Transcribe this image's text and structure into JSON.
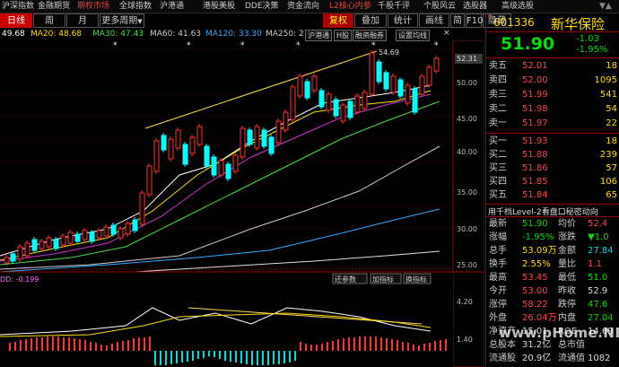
{
  "topnav": {
    "items": [
      "沪深指数",
      "金融期货",
      "期权市场",
      "全球指数",
      "沪港通",
      "港股美股",
      "DDE决策",
      "资金流向",
      "L2核心内参",
      "千股千评",
      "个股风云",
      "选股器",
      "高级选股"
    ],
    "active_index": 2,
    "highlight_index": 8,
    "arrows": "▼▲"
  },
  "toolbar": {
    "left_buttons": [
      "日线",
      "周",
      "月",
      "更多周期"
    ],
    "more_arrow": "▼",
    "right_buttons": [
      "复权",
      "叠加",
      "统计",
      "画线",
      "简",
      "F10",
      "隐藏"
    ]
  },
  "ma_legend": {
    "items": [
      {
        "text": "49.68",
        "color": "#ffffff"
      },
      {
        "text": "MA20: 48.68",
        "color": "#ffdd00"
      },
      {
        "text": "MA30: 47.43",
        "color": "#44dd44"
      },
      {
        "text": "MA60: 41.63",
        "color": "#cccccc"
      },
      {
        "text": "MA120: 33.30",
        "color": "#33aaff"
      },
      {
        "text": "MA250: 2",
        "color": "#cccccc"
      }
    ],
    "buttons": [
      "沪港通",
      "H股",
      "融资融券",
      "设置均线"
    ],
    "close_mark": "×"
  },
  "price_axis": {
    "labels": [
      "52.31",
      "50.00",
      "45.00",
      "40.00",
      "35.00",
      "30.00",
      "25.00"
    ],
    "highlight_label": "52.31",
    "peak_label": "54.69"
  },
  "indicator": {
    "label": "DD: -0.199",
    "buttons": [
      "还参数",
      "加指标",
      "换指标"
    ],
    "axis_labels": [
      "4.20",
      "1.40"
    ]
  },
  "quote": {
    "code": "601336",
    "name": "新华保险",
    "r_mark": "R",
    "price": "51.90",
    "change": "-1.03",
    "change_pct": "-1.95%",
    "asks": [
      {
        "label": "卖五",
        "price": "52.01",
        "vol": "18"
      },
      {
        "label": "卖四",
        "price": "52.00",
        "vol": "1095"
      },
      {
        "label": "卖三",
        "price": "51.99",
        "vol": "541"
      },
      {
        "label": "卖二",
        "price": "51.98",
        "vol": "54"
      },
      {
        "label": "卖一",
        "price": "51.97",
        "vol": "22"
      }
    ],
    "bids": [
      {
        "label": "买一",
        "price": "51.93",
        "vol": "18"
      },
      {
        "label": "买二",
        "price": "51.88",
        "vol": "239"
      },
      {
        "label": "买三",
        "price": "51.86",
        "vol": "57"
      },
      {
        "label": "买四",
        "price": "51.85",
        "vol": "106"
      },
      {
        "label": "买五",
        "price": "51.84",
        "vol": "65"
      }
    ],
    "promo": "用千档Level-2看盘口秘密动向",
    "stats": [
      {
        "l1": "最新",
        "v1": "51.90",
        "c1": "#00dd00",
        "l2": "均价",
        "v2": "52.4",
        "c2": "#ff4444"
      },
      {
        "l1": "涨幅",
        "v1": "-1.95%",
        "c1": "#00dd00",
        "l2": "涨跌",
        "v2": "▼1.0",
        "c2": "#00dd00"
      },
      {
        "l1": "总手",
        "v1": "53.09万",
        "c1": "#ffdd00",
        "l2": "金额",
        "v2": "27.84",
        "c2": "#00dddd"
      },
      {
        "l1": "换手",
        "v1": "2.55%",
        "c1": "#ffdd00",
        "l2": "量比",
        "v2": "1.1",
        "c2": "#ff4444"
      },
      {
        "l1": "最高",
        "v1": "53.45",
        "c1": "#ff4444",
        "l2": "最低",
        "v2": "51.0",
        "c2": "#00dd00"
      },
      {
        "l1": "今开",
        "v1": "53.00",
        "c1": "#ff4444",
        "l2": "昨收",
        "v2": "52.9",
        "c2": "#dddddd"
      },
      {
        "l1": "涨停",
        "v1": "58.22",
        "c1": "#ff4444",
        "l2": "跌停",
        "v2": "47.6",
        "c2": "#00dd00"
      },
      {
        "l1": "外盘",
        "v1": "26.04万",
        "c1": "#ff4444",
        "l2": "内盘",
        "v2": "27.04",
        "c2": "#00dd00"
      },
      {
        "l1": "净资产",
        "v1": "15.01",
        "c1": "#dddddd",
        "l2": "ROE",
        "v2": "14.69",
        "c2": "#dddddd"
      },
      {
        "l1": "总股本",
        "v1": "31.2亿",
        "c1": "#dddddd",
        "l2": "总市值",
        "v2": "",
        "c2": "#dddddd"
      },
      {
        "l1": "流通股",
        "v1": "20.9亿",
        "c1": "#dddddd",
        "l2": "流通值",
        "v2": "1082",
        "c2": "#dddddd"
      }
    ]
  },
  "watermark": "www.pHome.NET",
  "colors": {
    "up": "#ff3333",
    "down": "#00ffff",
    "panel_border": "#990000",
    "accent": "#cc0000"
  }
}
